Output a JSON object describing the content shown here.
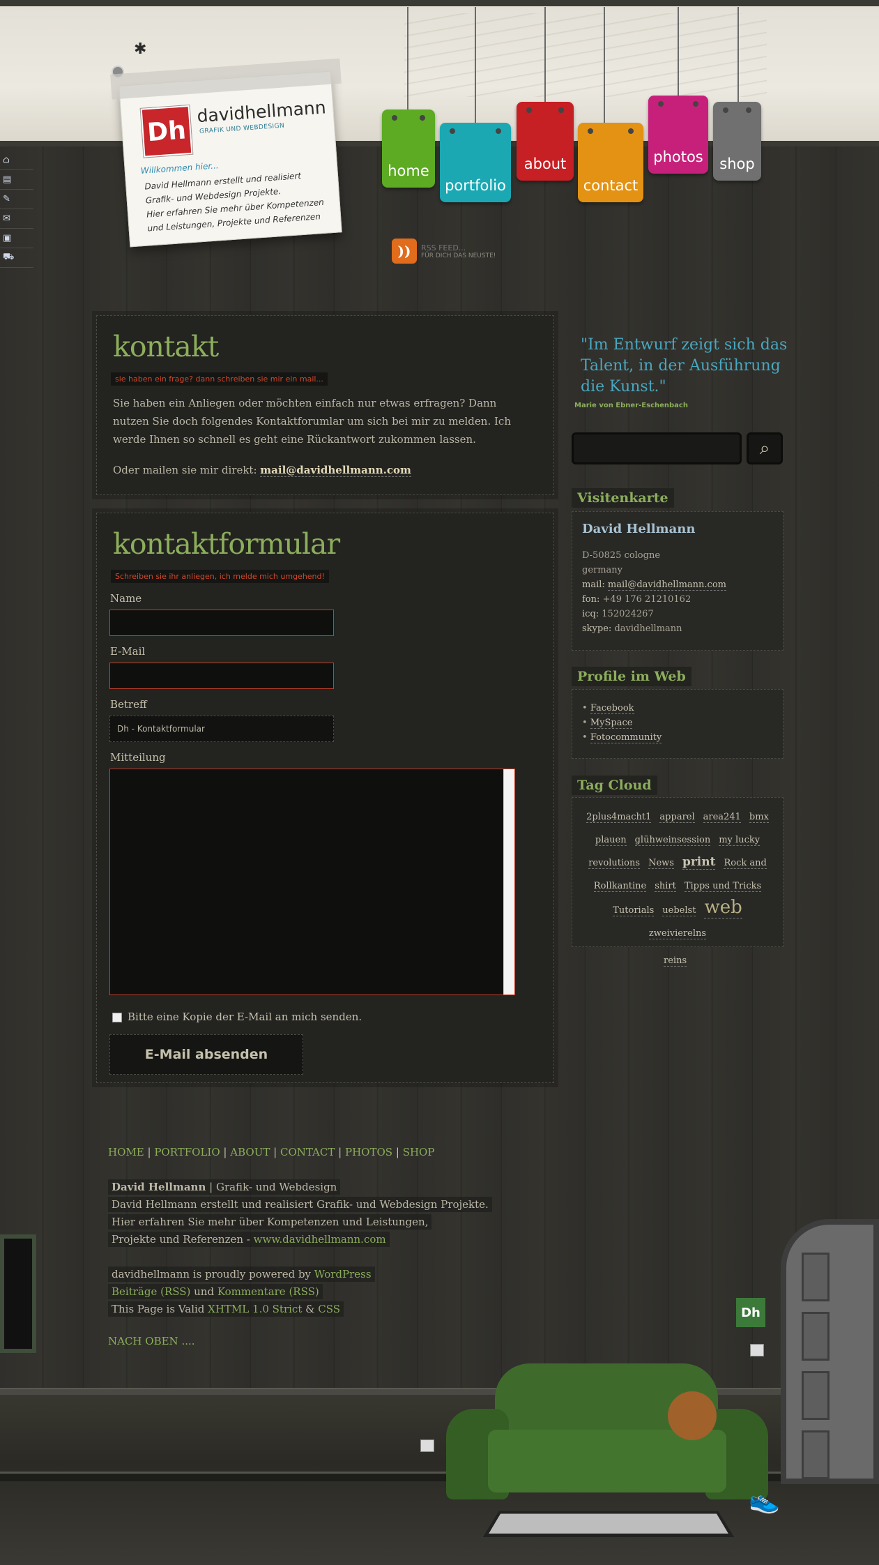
{
  "brand": {
    "logo_initials": "Dh",
    "name": "davidhellmann",
    "tagline": "GRAFIK UND WEBDESIGN"
  },
  "note": {
    "welcome": "Willkommen hier...",
    "lines": [
      "David Hellmann erstellt und realisiert",
      "Grafik- und Webdesign Projekte.",
      "Hier erfahren Sie mehr über Kompetenzen",
      "und Leistungen, Projekte und Referenzen"
    ]
  },
  "nav": [
    {
      "label": "home",
      "color": "#5cab23"
    },
    {
      "label": "portfolio",
      "color": "#1ba8b3"
    },
    {
      "label": "about",
      "color": "#c61f24"
    },
    {
      "label": "contact",
      "color": "#e39213"
    },
    {
      "label": "photos",
      "color": "#c7207b"
    },
    {
      "label": "shop",
      "color": "#707070"
    }
  ],
  "sideicons": [
    "home-icon",
    "page-icon",
    "edit-icon",
    "mail-icon",
    "photo-icon",
    "cart-icon"
  ],
  "rss": {
    "title": "RSS FEED...",
    "subtitle": "FÜR DICH DAS NEUSTE!"
  },
  "kontakt": {
    "title": "kontakt",
    "subtitle": "sie haben ein frage? dann schreiben sie mir ein mail...",
    "body": "Sie haben ein Anliegen oder möchten einfach nur etwas erfragen? Dann nutzen Sie doch folgendes Kontaktforumlar um sich bei mir zu melden. Ich werde Ihnen so schnell es geht eine Rückantwort zukommen lassen.",
    "mail_prefix": "Oder mailen sie mir direkt:",
    "mail": "mail@davidhellmann.com"
  },
  "form": {
    "title": "kontaktformular",
    "subtitle": "Schreiben sie ihr anliegen, ich melde mich umgehend!",
    "name_label": "Name",
    "email_label": "E-Mail",
    "subject_label": "Betreff",
    "subject_value": "Dh - Kontaktformular",
    "message_label": "Mitteilung",
    "copy_label": "Bitte eine Kopie der E-Mail an mich senden.",
    "submit": "E-Mail absenden"
  },
  "quote": {
    "text": "\"Im Entwurf zeigt sich das Talent, in der Ausführung die Kunst.\"",
    "author": "Marie von Ebner-Eschenbach"
  },
  "visitenkarte": {
    "title": "Visitenkarte",
    "name": "David Hellmann",
    "city": "D-50825 cologne",
    "country": "germany",
    "mail_label": "mail:",
    "mail": "mail@davidhellmann.com",
    "fon_label": "fon:",
    "fon": "+49 176 21210162",
    "icq_label": "icq:",
    "icq": "152024267",
    "skype_label": "skype:",
    "skype": "davidhellmann"
  },
  "profile": {
    "title": "Profile im Web",
    "items": [
      "Facebook",
      "MySpace",
      "Fotocommunity"
    ]
  },
  "tagcloud": {
    "title": "Tag Cloud",
    "rows": [
      [
        "2plus4macht1",
        "apparel",
        "area241",
        "bmx"
      ],
      [
        "plauen",
        "glühweinsession",
        "my lucky"
      ],
      [
        "revolutions",
        "News",
        "print",
        "Rock and"
      ],
      [
        "Rollkantine",
        "shirt",
        "Tipps und Tricks"
      ],
      [
        "Tutorials",
        "uebelst",
        "web"
      ],
      [
        "zweivierelns"
      ]
    ],
    "extra": "reins"
  },
  "footer": {
    "nav": [
      "HOME",
      "PORTFOLIO",
      "ABOUT",
      "CONTACT",
      "PHOTOS",
      "SHOP"
    ],
    "bold_name": "David Hellmann",
    "line1_rest": " | Grafik- und Webdesign",
    "line2": "David Hellmann erstellt und realisiert Grafik- und Webdesign Projekte.",
    "line3": "Hier erfahren Sie mehr über Kompetenzen und Leistungen,",
    "line4_prefix": "Projekte und Referenzen - ",
    "line4_link": "www.davidhellmann.com",
    "powered_prefix": "davidhellmann is proudly powered by ",
    "powered_link": "WordPress",
    "feeds_a": "Beiträge (RSS)",
    "feeds_mid": " und ",
    "feeds_b": "Kommentare (RSS)",
    "valid_prefix": "This Page is Valid ",
    "valid_a": "XHTML 1.0 Strict",
    "valid_mid": " & ",
    "valid_b": "CSS",
    "top_link": "NACH OBEN ...."
  },
  "badge": "Dh"
}
